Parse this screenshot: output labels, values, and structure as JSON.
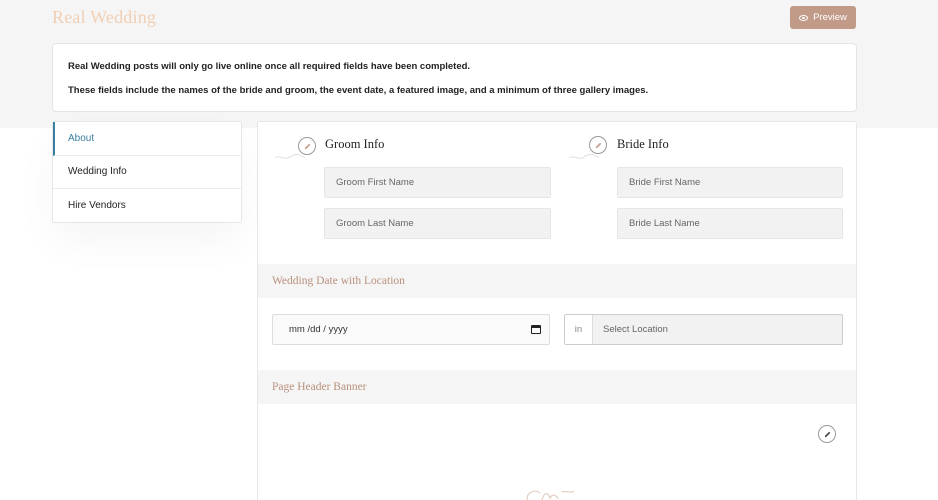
{
  "header": {
    "title": "Real Wedding",
    "preview_label": "Preview"
  },
  "notice": {
    "line1": "Real Wedding posts will only go live online once all required fields have been completed.",
    "line2": "These fields include the names of the bride and groom, the event date, a featured image, and a minimum of three gallery images."
  },
  "sidebar": {
    "items": [
      {
        "label": "About",
        "active": true
      },
      {
        "label": "Wedding Info",
        "active": false
      },
      {
        "label": "Hire Vendors",
        "active": false
      }
    ]
  },
  "groom": {
    "title": "Groom Info",
    "first_placeholder": "Groom First Name",
    "last_placeholder": "Groom Last Name"
  },
  "bride": {
    "title": "Bride Info",
    "first_placeholder": "Bride First Name",
    "last_placeholder": "Bride Last Name"
  },
  "wedding_date": {
    "section_title": "Wedding Date with Location",
    "date_placeholder": "mm /dd / yyyy",
    "location_prefix": "in",
    "location_placeholder": "Select Location"
  },
  "banner": {
    "section_title": "Page Header Banner"
  },
  "colors": {
    "accent": "#c19a88",
    "title": "#f1cfb3",
    "active_link": "#3a7fa0",
    "section_title": "#b9917c"
  }
}
